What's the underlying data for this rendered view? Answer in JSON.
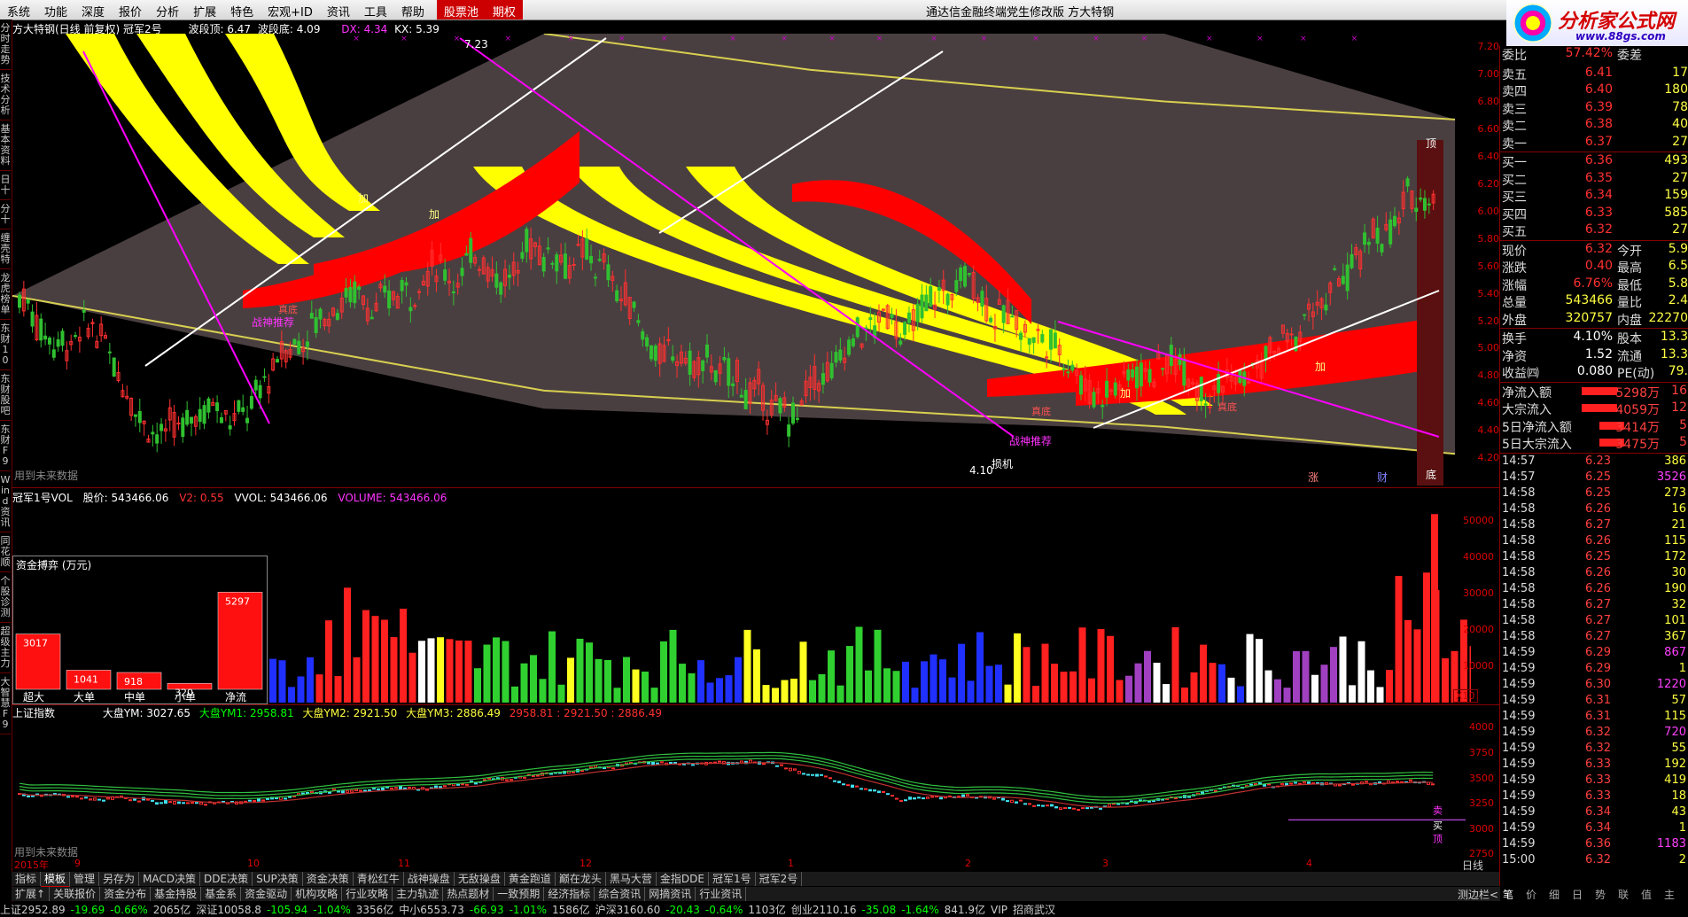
{
  "menu": {
    "items": [
      "系统",
      "功能",
      "深度",
      "报价",
      "分析",
      "扩展",
      "特色",
      "宏观+ID",
      "资讯",
      "工具",
      "帮助"
    ],
    "highlight_items": [
      "股票池",
      "期权"
    ],
    "title": "通达信金融终端党生修改版    方大特钢"
  },
  "logo": {
    "main": "分析家公式网",
    "url": "www.88gs.com"
  },
  "left_tabs": [
    "分时走势",
    "技术分析",
    "基本资料",
    "日十",
    "分十",
    "缠壳特",
    "龙虎榜单",
    "东财10",
    "东财股吧",
    "东财F9",
    "Wind资讯",
    "同花顺",
    "个股诊测",
    "超级主力",
    "大智慧F9"
  ],
  "main_chart": {
    "header_title": "方大特钢(日线 前复权) 冠军2号",
    "wave_top": "波段顶: 6.47",
    "wave_bottom": "波段底: 4.09",
    "dx": "DX: 4.34",
    "kx": "KX: 5.39",
    "high_label": "7.23",
    "low_label": "4.10",
    "future_note": "用到未来数据",
    "stop_loss": "损机",
    "ding": "顶",
    "di": "底",
    "zhang": "涨",
    "cai": "财",
    "zhanshen": "战神推荐",
    "jia": "加",
    "zhen": "真底",
    "y_ticks": [
      "7.20",
      "7.00",
      "6.80",
      "6.60",
      "6.40",
      "6.20",
      "6.00",
      "5.80",
      "5.60",
      "5.40",
      "5.20",
      "5.00",
      "4.80",
      "4.60",
      "4.40",
      "4.20"
    ]
  },
  "vol_chart": {
    "header_name": "冠军1号VOL",
    "gujia": "股价: 543466.06",
    "v2": "V2: 0.55",
    "vvol": "VVOL: 543466.06",
    "volume": "VOLUME: 543466.06",
    "y_ticks": [
      "50000",
      "40000",
      "30000",
      "20000",
      "10000"
    ],
    "x10": "X10",
    "fund_box_title": "资金搏弈 (万元)",
    "fund_box": [
      {
        "label": "超大",
        "value": "3017"
      },
      {
        "label": "大单",
        "value": "1041"
      },
      {
        "label": "中单",
        "value": "918"
      },
      {
        "label": "小单",
        "value": "320"
      },
      {
        "label": "净流",
        "value": "5297"
      }
    ]
  },
  "index_chart": {
    "name": "上证指数",
    "ym": "大盘YM: 3027.65",
    "ym1": "大盘YM1: 2958.81",
    "ym2": "大盘YM2: 2921.50",
    "ym3": "大盘YM3: 2886.49",
    "extra": "2958.81 : 2921.50 : 2886.49",
    "future_note": "用到未来数据",
    "y_ticks": [
      "4000",
      "3750",
      "3500",
      "3250",
      "3000",
      "2750"
    ],
    "x_labels": [
      "2015年",
      "9",
      "10",
      "11",
      "12",
      "1",
      "2",
      "3",
      "4"
    ],
    "rixian": "日线",
    "mai": "卖",
    "mai2": "买",
    "ding": "顶"
  },
  "quote": {
    "webi_k": "委比",
    "webi_v": "57.42%",
    "wecha_k": "委差",
    "asks": [
      {
        "k": "卖五",
        "p": "6.41",
        "v": "17"
      },
      {
        "k": "卖四",
        "p": "6.40",
        "v": "180"
      },
      {
        "k": "卖三",
        "p": "6.39",
        "v": "78"
      },
      {
        "k": "卖二",
        "p": "6.38",
        "v": "40"
      },
      {
        "k": "卖一",
        "p": "6.37",
        "v": "27"
      }
    ],
    "bids": [
      {
        "k": "买一",
        "p": "6.36",
        "v": "493"
      },
      {
        "k": "买二",
        "p": "6.35",
        "v": "27"
      },
      {
        "k": "买三",
        "p": "6.34",
        "v": "159"
      },
      {
        "k": "买四",
        "p": "6.33",
        "v": "585"
      },
      {
        "k": "买五",
        "p": "6.32",
        "v": "27"
      }
    ],
    "stats": [
      {
        "k": "现价",
        "v": "6.32",
        "k2": "今开",
        "v2": "5.9"
      },
      {
        "k": "涨跌",
        "v": "0.40",
        "k2": "最高",
        "v2": "6.5"
      },
      {
        "k": "涨幅",
        "v": "6.76%",
        "k2": "最低",
        "v2": "5.8"
      },
      {
        "k": "总量",
        "v": "543466",
        "k2": "量比",
        "v2": "2.4"
      },
      {
        "k": "外盘",
        "v": "320757",
        "k2": "内盘",
        "v2": "22270"
      }
    ],
    "stats2": [
      {
        "k": "换手",
        "v": "4.10%",
        "k2": "股本",
        "v2": "13.3"
      },
      {
        "k": "净资",
        "v": "1.52",
        "k2": "流通",
        "v2": "13.3"
      },
      {
        "k": "收益㈣",
        "v": "0.080",
        "k2": "PE(动)",
        "v2": "79."
      }
    ],
    "flows": [
      {
        "k": "净流入额",
        "v": "5298万",
        "c": "16"
      },
      {
        "k": "大宗流入",
        "v": "4059万",
        "c": "12"
      },
      {
        "k": "5日净流入额",
        "v": "3414万",
        "c": "5"
      },
      {
        "k": "5日大宗流入",
        "v": "3475万",
        "c": "5"
      }
    ],
    "ticks": [
      {
        "t": "14:57",
        "p": "6.23",
        "v": "386"
      },
      {
        "t": "14:57",
        "p": "6.25",
        "v": "3526"
      },
      {
        "t": "14:58",
        "p": "6.25",
        "v": "273"
      },
      {
        "t": "14:58",
        "p": "6.26",
        "v": "16"
      },
      {
        "t": "14:58",
        "p": "6.27",
        "v": "21"
      },
      {
        "t": "14:58",
        "p": "6.26",
        "v": "115"
      },
      {
        "t": "14:58",
        "p": "6.25",
        "v": "172"
      },
      {
        "t": "14:58",
        "p": "6.26",
        "v": "30"
      },
      {
        "t": "14:58",
        "p": "6.26",
        "v": "190"
      },
      {
        "t": "14:58",
        "p": "6.27",
        "v": "32"
      },
      {
        "t": "14:58",
        "p": "6.27",
        "v": "101"
      },
      {
        "t": "14:58",
        "p": "6.27",
        "v": "367"
      },
      {
        "t": "14:59",
        "p": "6.29",
        "v": "867"
      },
      {
        "t": "14:59",
        "p": "6.29",
        "v": "1"
      },
      {
        "t": "14:59",
        "p": "6.30",
        "v": "1220"
      },
      {
        "t": "14:59",
        "p": "6.31",
        "v": "57"
      },
      {
        "t": "14:59",
        "p": "6.31",
        "v": "115"
      },
      {
        "t": "14:59",
        "p": "6.32",
        "v": "720"
      },
      {
        "t": "14:59",
        "p": "6.32",
        "v": "55"
      },
      {
        "t": "14:59",
        "p": "6.33",
        "v": "192"
      },
      {
        "t": "14:59",
        "p": "6.33",
        "v": "419"
      },
      {
        "t": "14:59",
        "p": "6.33",
        "v": "18"
      },
      {
        "t": "14:59",
        "p": "6.34",
        "v": "43"
      },
      {
        "t": "14:59",
        "p": "6.34",
        "v": "1"
      },
      {
        "t": "14:59",
        "p": "6.36",
        "v": "1183"
      },
      {
        "t": "15:00",
        "p": "6.32",
        "v": "2"
      }
    ]
  },
  "right_tabs": [
    "笔",
    "价",
    "细",
    "日",
    "势",
    "联",
    "值",
    "主"
  ],
  "bottom_tabs_1": [
    "指标",
    "模板",
    "管理",
    "另存为",
    "MACD决策",
    "DDE决策",
    "SUP决策",
    "资金决策",
    "青松红牛",
    "战神操盘",
    "无敌操盘",
    "黄金跑道",
    "巅在龙头",
    "黑马大营",
    "金指DDE",
    "冠军1号",
    "冠军2号"
  ],
  "bottom_tabs_2": [
    "扩展↑",
    "关联报价",
    "资金分布",
    "基金持股",
    "基金系",
    "资金驱动",
    "机构攻略",
    "行业攻略",
    "主力轨迹",
    "热点题材",
    "一致预期",
    "经济指标",
    "综合资讯",
    "网摘资讯",
    "行业资讯"
  ],
  "status_bar": [
    "上证2952.89",
    "-19.69",
    "-0.66%",
    "2065亿",
    "深证10058.8",
    "-105.94",
    "-1.04%",
    "3356亿",
    "中小6553.73",
    "-66.93",
    "-1.01%",
    "1586亿",
    "沪深3160.60",
    "-20.43",
    "-0.64%",
    "1103亿",
    "创业2110.16",
    "-35.08",
    "-1.64%",
    "841.9亿",
    "VIP",
    "招商武汉"
  ],
  "chart_data": {
    "type": "candlestick",
    "volume_values_relative_max": 52000,
    "price_range": [
      4.09,
      7.23
    ],
    "index_range": [
      2700,
      4100
    ]
  },
  "colors": {
    "price_red": "#ff3030",
    "yellow": "#ffff40",
    "ribbon_yellow": "#ffff00",
    "ribbon_red": "#ff0000",
    "bg_band": "#4a3f40",
    "panel_border": "#800000"
  }
}
